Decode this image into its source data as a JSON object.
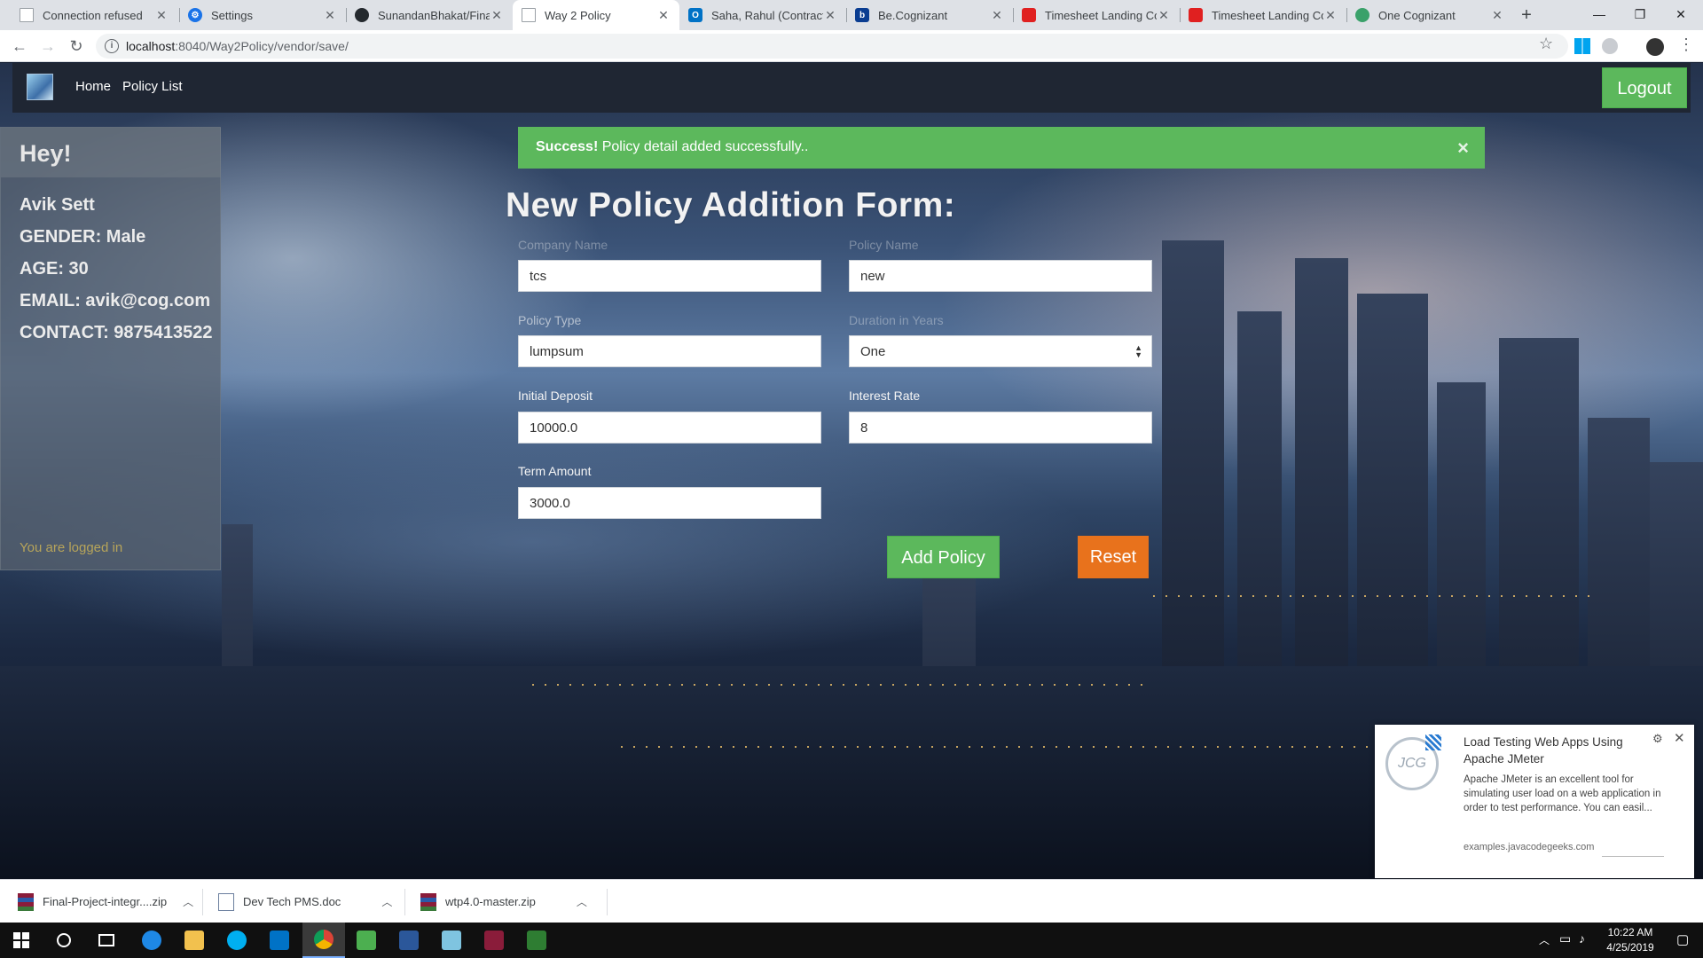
{
  "browser": {
    "tabs": [
      {
        "title": "Connection refused",
        "icon": "page-icon",
        "color": "#9aa0a6"
      },
      {
        "title": "Settings",
        "icon": "gear-icon",
        "color": "#1a73e8"
      },
      {
        "title": "SunandanBhakat/Final-",
        "icon": "github-icon",
        "color": "#24292e"
      },
      {
        "title": "Way 2 Policy",
        "icon": "page-icon",
        "color": "#9aa0a6"
      },
      {
        "title": "Saha, Rahul (Contractor",
        "icon": "outlook-icon",
        "color": "#0072c6"
      },
      {
        "title": "Be.Cognizant",
        "icon": "be-cognizant-icon",
        "color": "#0a3d91"
      },
      {
        "title": "Timesheet Landing Con",
        "icon": "timesheet-icon",
        "color": "#e02020"
      },
      {
        "title": "Timesheet Landing Con",
        "icon": "timesheet-icon",
        "color": "#e02020"
      },
      {
        "title": "One Cognizant",
        "icon": "one-cognizant-icon",
        "color": "#3aa16a"
      }
    ],
    "active_tab": 3,
    "url_host": "localhost",
    "url_path": ":8040/Way2Policy/vendor/save/"
  },
  "site": {
    "nav": {
      "home": "Home",
      "policy_list": "Policy List",
      "logout": "Logout"
    },
    "profile": {
      "greeting": "Hey!",
      "name": "Avik  Sett",
      "gender": "GENDER: Male",
      "age": "AGE: 30",
      "email": "EMAIL: avik@cog.com",
      "contact": "CONTACT: 9875413522",
      "status": "You are logged in"
    },
    "alert": {
      "strong": "Success!",
      "message": " Policy detail added successfully..",
      "close": "×"
    },
    "form": {
      "title": "New Policy Addition Form:",
      "fields": {
        "company_name": {
          "label": "Company Name",
          "value": "tcs"
        },
        "policy_name": {
          "label": "Policy Name",
          "value": "new"
        },
        "policy_type": {
          "label": "Policy Type",
          "value": "lumpsum"
        },
        "duration": {
          "label": "Duration in Years",
          "value": "One"
        },
        "initial_deposit": {
          "label": "Initial Deposit",
          "value": "10000.0"
        },
        "interest_rate": {
          "label": "Interest Rate",
          "value": "8"
        },
        "term_amount": {
          "label": "Term Amount",
          "value": "3000.0"
        }
      },
      "add_button": "Add Policy",
      "reset_button": "Reset"
    }
  },
  "notification": {
    "logo_text": "JCG",
    "title": "Load Testing Web Apps Using Apache JMeter",
    "body": "Apache JMeter is an excellent tool for simulating user load on a web application in order to test performance. You can easil...",
    "source": "examples.javacodegeeks.com"
  },
  "downloads": [
    {
      "name": "Final-Project-integr....zip",
      "type": "zip"
    },
    {
      "name": "Dev Tech PMS.doc",
      "type": "doc"
    },
    {
      "name": "wtp4.0-master.zip",
      "type": "zip"
    }
  ],
  "taskbar": {
    "apps": [
      {
        "name": "start-icon",
        "color": "#ffffff"
      },
      {
        "name": "search-icon",
        "color": "#ffffff"
      },
      {
        "name": "task-view-icon",
        "color": "#ffffff"
      },
      {
        "name": "edge-icon",
        "color": "#1e88e5"
      },
      {
        "name": "file-explorer-icon",
        "color": "#f2c14e"
      },
      {
        "name": "skype-icon",
        "color": "#00aff0"
      },
      {
        "name": "outlook-icon",
        "color": "#0072c6"
      },
      {
        "name": "chrome-icon",
        "color": "#e5a50a"
      },
      {
        "name": "media-icon",
        "color": "#4caf50"
      },
      {
        "name": "word-icon",
        "color": "#2b579a"
      },
      {
        "name": "notes-icon",
        "color": "#7fc4e0"
      },
      {
        "name": "archive-icon",
        "color": "#8a1c3a"
      },
      {
        "name": "spreadsheet-icon",
        "color": "#2e7d32"
      }
    ],
    "time": "10:22 AM",
    "date": "4/25/2019"
  }
}
